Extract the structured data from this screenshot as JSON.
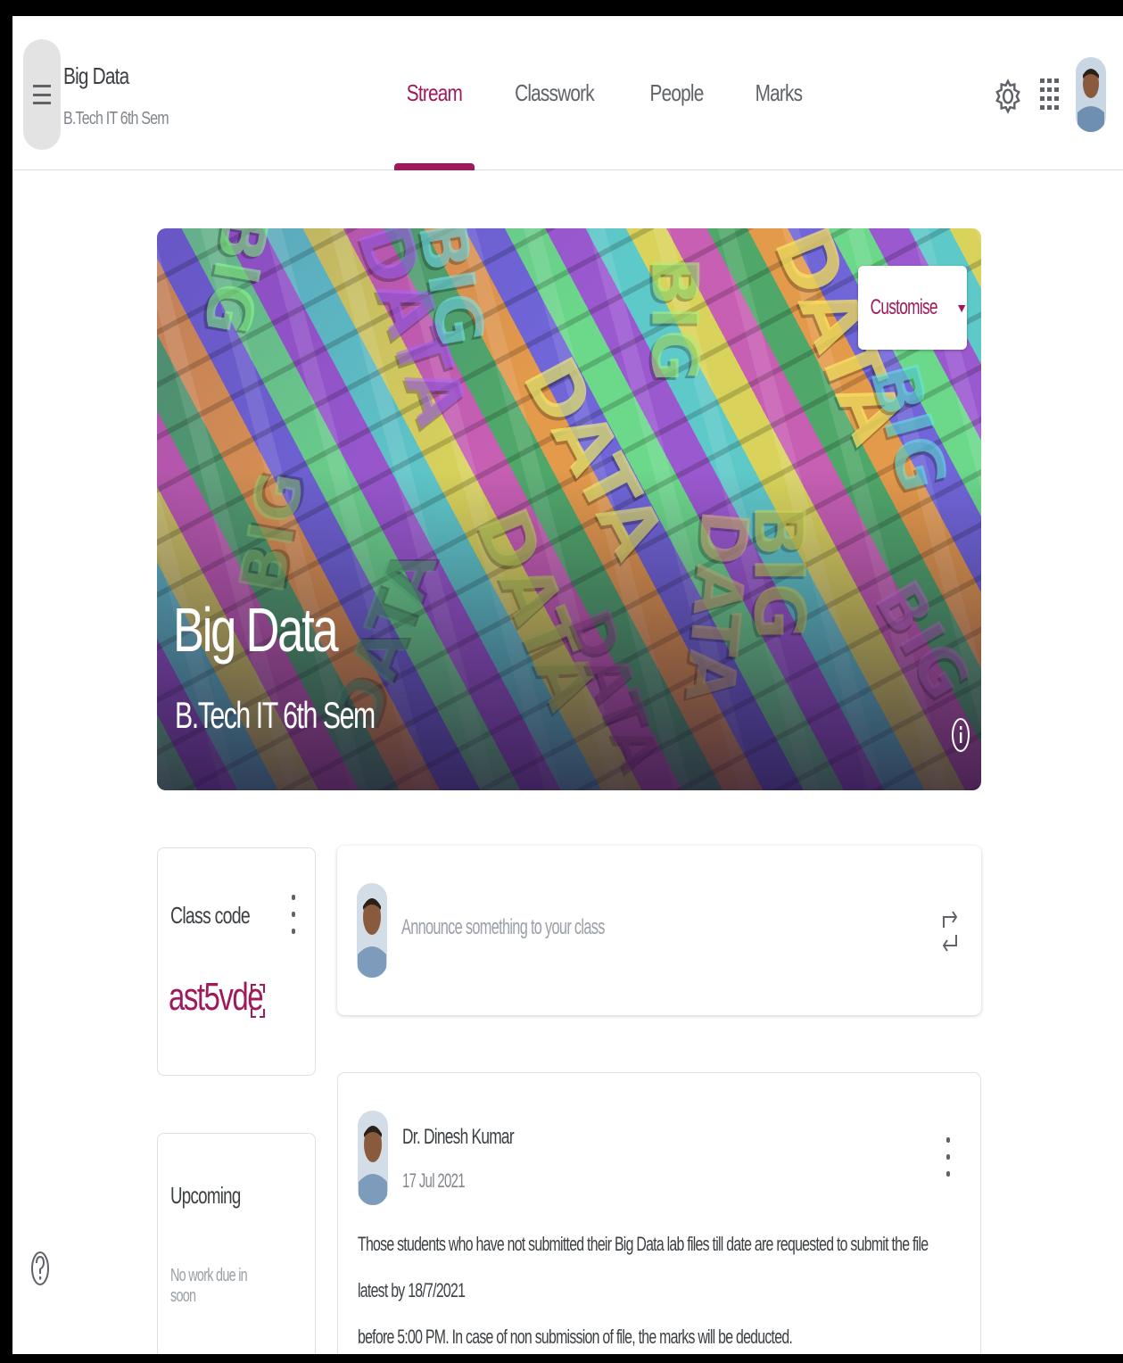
{
  "header": {
    "class_title": "Big Data",
    "class_subtitle": "B.Tech IT 6th Sem",
    "tabs": [
      {
        "label": "Stream",
        "active": true
      },
      {
        "label": "Classwork",
        "active": false
      },
      {
        "label": "People",
        "active": false
      },
      {
        "label": "Marks",
        "active": false
      }
    ],
    "icons": {
      "menu": "menu-icon",
      "settings": "gear-icon",
      "apps": "apps-grid-icon",
      "account": "avatar"
    }
  },
  "banner": {
    "title": "Big Data",
    "subtitle": "B.Tech IT 6th Sem",
    "customise_label": "Customise",
    "customise_caret": "▼",
    "background_words": [
      "BIG",
      "DATA",
      "BIG",
      "DATA",
      "BIG",
      "DATA",
      "BIG",
      "DATA",
      "BIG",
      "DATA",
      "BIG",
      "DATA",
      "BIG",
      "DATA"
    ]
  },
  "class_code": {
    "label": "Class code",
    "value": "ast5vde"
  },
  "upcoming": {
    "title": "Upcoming",
    "empty_text": "No work due in soon"
  },
  "announce": {
    "placeholder": "Announce something to your class"
  },
  "post": {
    "author": "Dr. Dinesh Kumar",
    "date": "17 Jul 2021",
    "body_line1": "Those students who have not submitted their Big Data lab files till date are requested to submit the file latest by 18/7/2021",
    "body_line2": "before 5:00 PM. In case of non submission of file, the marks will be deducted."
  },
  "colors": {
    "accent": "#a0195a",
    "divider": "#dadce0",
    "text_secondary": "#80868b"
  }
}
